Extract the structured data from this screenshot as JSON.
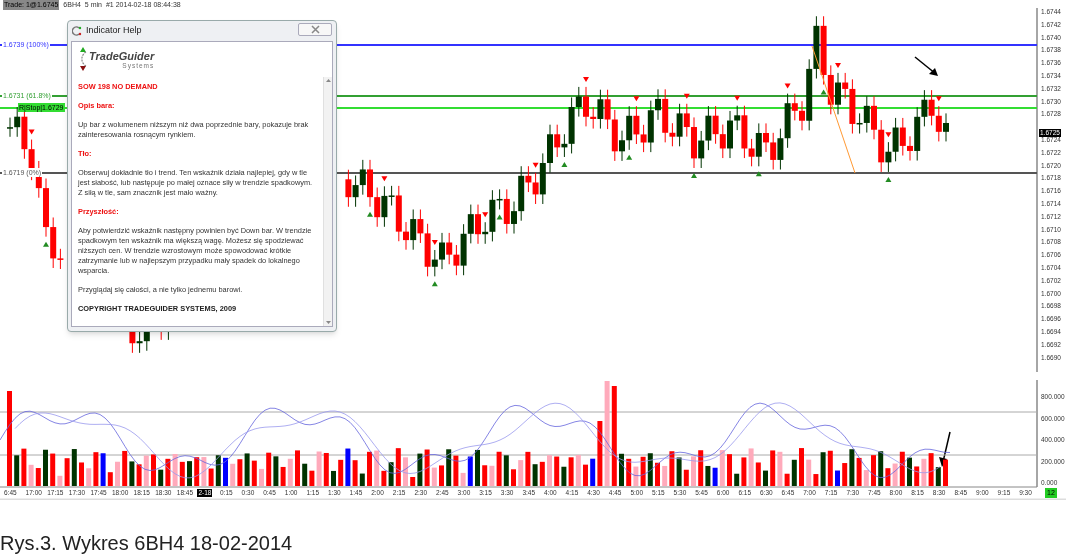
{
  "header": {
    "trade": "Trade: 1@1.6745",
    "symbol": "6BH4",
    "interval": "5 min",
    "info": "#1 2014-02-18 08:44:38"
  },
  "levels": [
    {
      "label": "1.6739 (100%)",
      "color": "#3333ff",
      "kind": "fib"
    },
    {
      "label": "1.6731 (61.8%)",
      "color": "#33a033",
      "kind": "fib"
    },
    {
      "label": "R|Stop|1.6729",
      "color": "#33dd33",
      "kind": "stop"
    },
    {
      "label": "1.6719 (0%)",
      "color": "#555555",
      "kind": "fib"
    }
  ],
  "price_axis": [
    "1.6744",
    "1.6742",
    "1.6740",
    "1.6738",
    "1.6736",
    "1.6734",
    "1.6732",
    "1.6730",
    "1.6728",
    "1.6724",
    "1.6722",
    "1.6720",
    "1.6718",
    "1.6716",
    "1.6714",
    "1.6712",
    "1.6710",
    "1.6708",
    "1.6706",
    "1.6704",
    "1.6702",
    "1.6700",
    "1.6698",
    "1.6696",
    "1.6694",
    "1.6692",
    "1.6690"
  ],
  "current_price": "1.6725",
  "volume_axis": [
    "800.000",
    "600.000",
    "400.000",
    "200.000",
    "0.000"
  ],
  "time_axis": [
    {
      "label": "6:45",
      "kind": "time"
    },
    {
      "label": "17:00",
      "kind": "time"
    },
    {
      "label": "17:15",
      "kind": "time"
    },
    {
      "label": "17:30",
      "kind": "time"
    },
    {
      "label": "17:45",
      "kind": "time"
    },
    {
      "label": "18:00",
      "kind": "time"
    },
    {
      "label": "18:15",
      "kind": "time"
    },
    {
      "label": "18:30",
      "kind": "time"
    },
    {
      "label": "18:45",
      "kind": "time"
    },
    {
      "label": "2-18",
      "kind": "date"
    },
    {
      "label": "0:15",
      "kind": "time"
    },
    {
      "label": "0:30",
      "kind": "time"
    },
    {
      "label": "0:45",
      "kind": "time"
    },
    {
      "label": "1:00",
      "kind": "time"
    },
    {
      "label": "1:15",
      "kind": "time"
    },
    {
      "label": "1:30",
      "kind": "time"
    },
    {
      "label": "1:45",
      "kind": "time"
    },
    {
      "label": "2:00",
      "kind": "time"
    },
    {
      "label": "2:15",
      "kind": "time"
    },
    {
      "label": "2:30",
      "kind": "time"
    },
    {
      "label": "2:45",
      "kind": "time"
    },
    {
      "label": "3:00",
      "kind": "time"
    },
    {
      "label": "3:15",
      "kind": "time"
    },
    {
      "label": "3:30",
      "kind": "time"
    },
    {
      "label": "3:45",
      "kind": "time"
    },
    {
      "label": "4:00",
      "kind": "time"
    },
    {
      "label": "4:15",
      "kind": "time"
    },
    {
      "label": "4:30",
      "kind": "time"
    },
    {
      "label": "4:45",
      "kind": "time"
    },
    {
      "label": "5:00",
      "kind": "time"
    },
    {
      "label": "5:15",
      "kind": "time"
    },
    {
      "label": "5:30",
      "kind": "time"
    },
    {
      "label": "5:45",
      "kind": "time"
    },
    {
      "label": "6:00",
      "kind": "time"
    },
    {
      "label": "6:15",
      "kind": "time"
    },
    {
      "label": "6:30",
      "kind": "time"
    },
    {
      "label": "6:45",
      "kind": "time"
    },
    {
      "label": "7:00",
      "kind": "time"
    },
    {
      "label": "7:15",
      "kind": "time"
    },
    {
      "label": "7:30",
      "kind": "time"
    },
    {
      "label": "7:45",
      "kind": "time"
    },
    {
      "label": "8:00",
      "kind": "time"
    },
    {
      "label": "8:15",
      "kind": "time"
    },
    {
      "label": "8:30",
      "kind": "time"
    },
    {
      "label": "8:45",
      "kind": "time"
    },
    {
      "label": "9:00",
      "kind": "time"
    },
    {
      "label": "9:15",
      "kind": "time"
    },
    {
      "label": "9:30",
      "kind": "time"
    }
  ],
  "corner_badge": "12",
  "dialog": {
    "title": "Indicator Help",
    "logo": {
      "name": "TradeGuider",
      "sub": "Systems"
    },
    "blocks": [
      {
        "kind": "title",
        "text": "SOW 198 NO DEMAND"
      },
      {
        "kind": "heading",
        "text": "Opis bara:"
      },
      {
        "kind": "paragraph",
        "text": "Up bar z wolumenem niższym niż dwa poprzednie bary, pokazuje brak zainteresowania rosnącym rynkiem."
      },
      {
        "kind": "heading",
        "text": "Tło:"
      },
      {
        "kind": "paragraph",
        "text": "Obserwuj dokładnie tło i trend. Ten wskaźnik działa najlepiej, gdy w tle jest słabość, lub następuje po małej oznace siły w trendzie spadkowym. Z siłą w tle, sam znacznik jest mało ważny."
      },
      {
        "kind": "heading",
        "text": "Przyszłość:"
      },
      {
        "kind": "paragraph",
        "text": "Aby potwierdzić wskaźnik następny powinien być Down bar. W trendzie spadkowym ten wskaźnik ma większą wagę. Możesz się spodziewać niższych cen. W trendzie wzrostowym może spowodować krótkie zatrzymanie lub w najlepszym przypadku mały spadek do lokalnego wsparcia."
      },
      {
        "kind": "paragraph",
        "text": "Przyglądaj się całości, a nie tylko jednemu barowi."
      },
      {
        "kind": "copyright",
        "text": "COPYRIGHT TRADEGUIDER SYSTEMS, 2009"
      }
    ]
  },
  "caption": "Rys.3. Wykres 6BH4 18-02-2014"
}
